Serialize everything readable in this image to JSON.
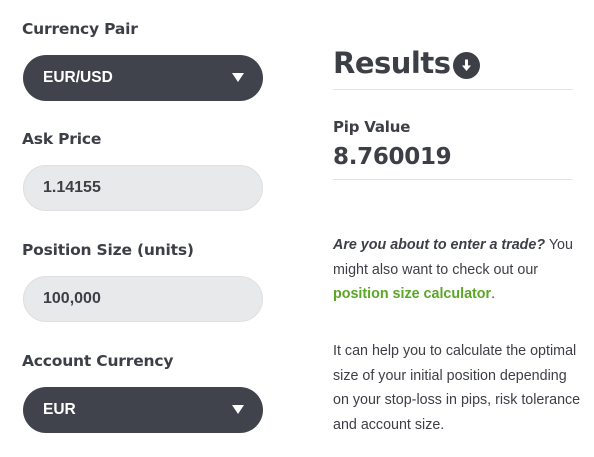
{
  "form": {
    "currency_pair": {
      "label": "Currency Pair",
      "value": "EUR/USD"
    },
    "ask_price": {
      "label": "Ask Price",
      "value": "1.14155"
    },
    "position_size": {
      "label": "Position Size (units)",
      "value": "100,000"
    },
    "account_currency": {
      "label": "Account Currency",
      "value": "EUR"
    }
  },
  "results": {
    "title": "Results",
    "pip_value_label": "Pip Value",
    "pip_value": "8.760019"
  },
  "info": {
    "question": "Are you about to enter a trade?",
    "text_after_question": " You might also want to check out our ",
    "link_text": "position size calculator",
    "text_after_link": ".",
    "paragraph2": "It can help you to calculate the optimal size of your initial position depending on your stop-loss in pips, risk tolerance and account size."
  },
  "colors": {
    "select_bg": "#41434c",
    "input_bg": "#e8e9eb",
    "text": "#3d3f46",
    "link": "#5ba627"
  },
  "icons": {
    "download": "download-icon",
    "dropdown": "caret-down-icon"
  }
}
